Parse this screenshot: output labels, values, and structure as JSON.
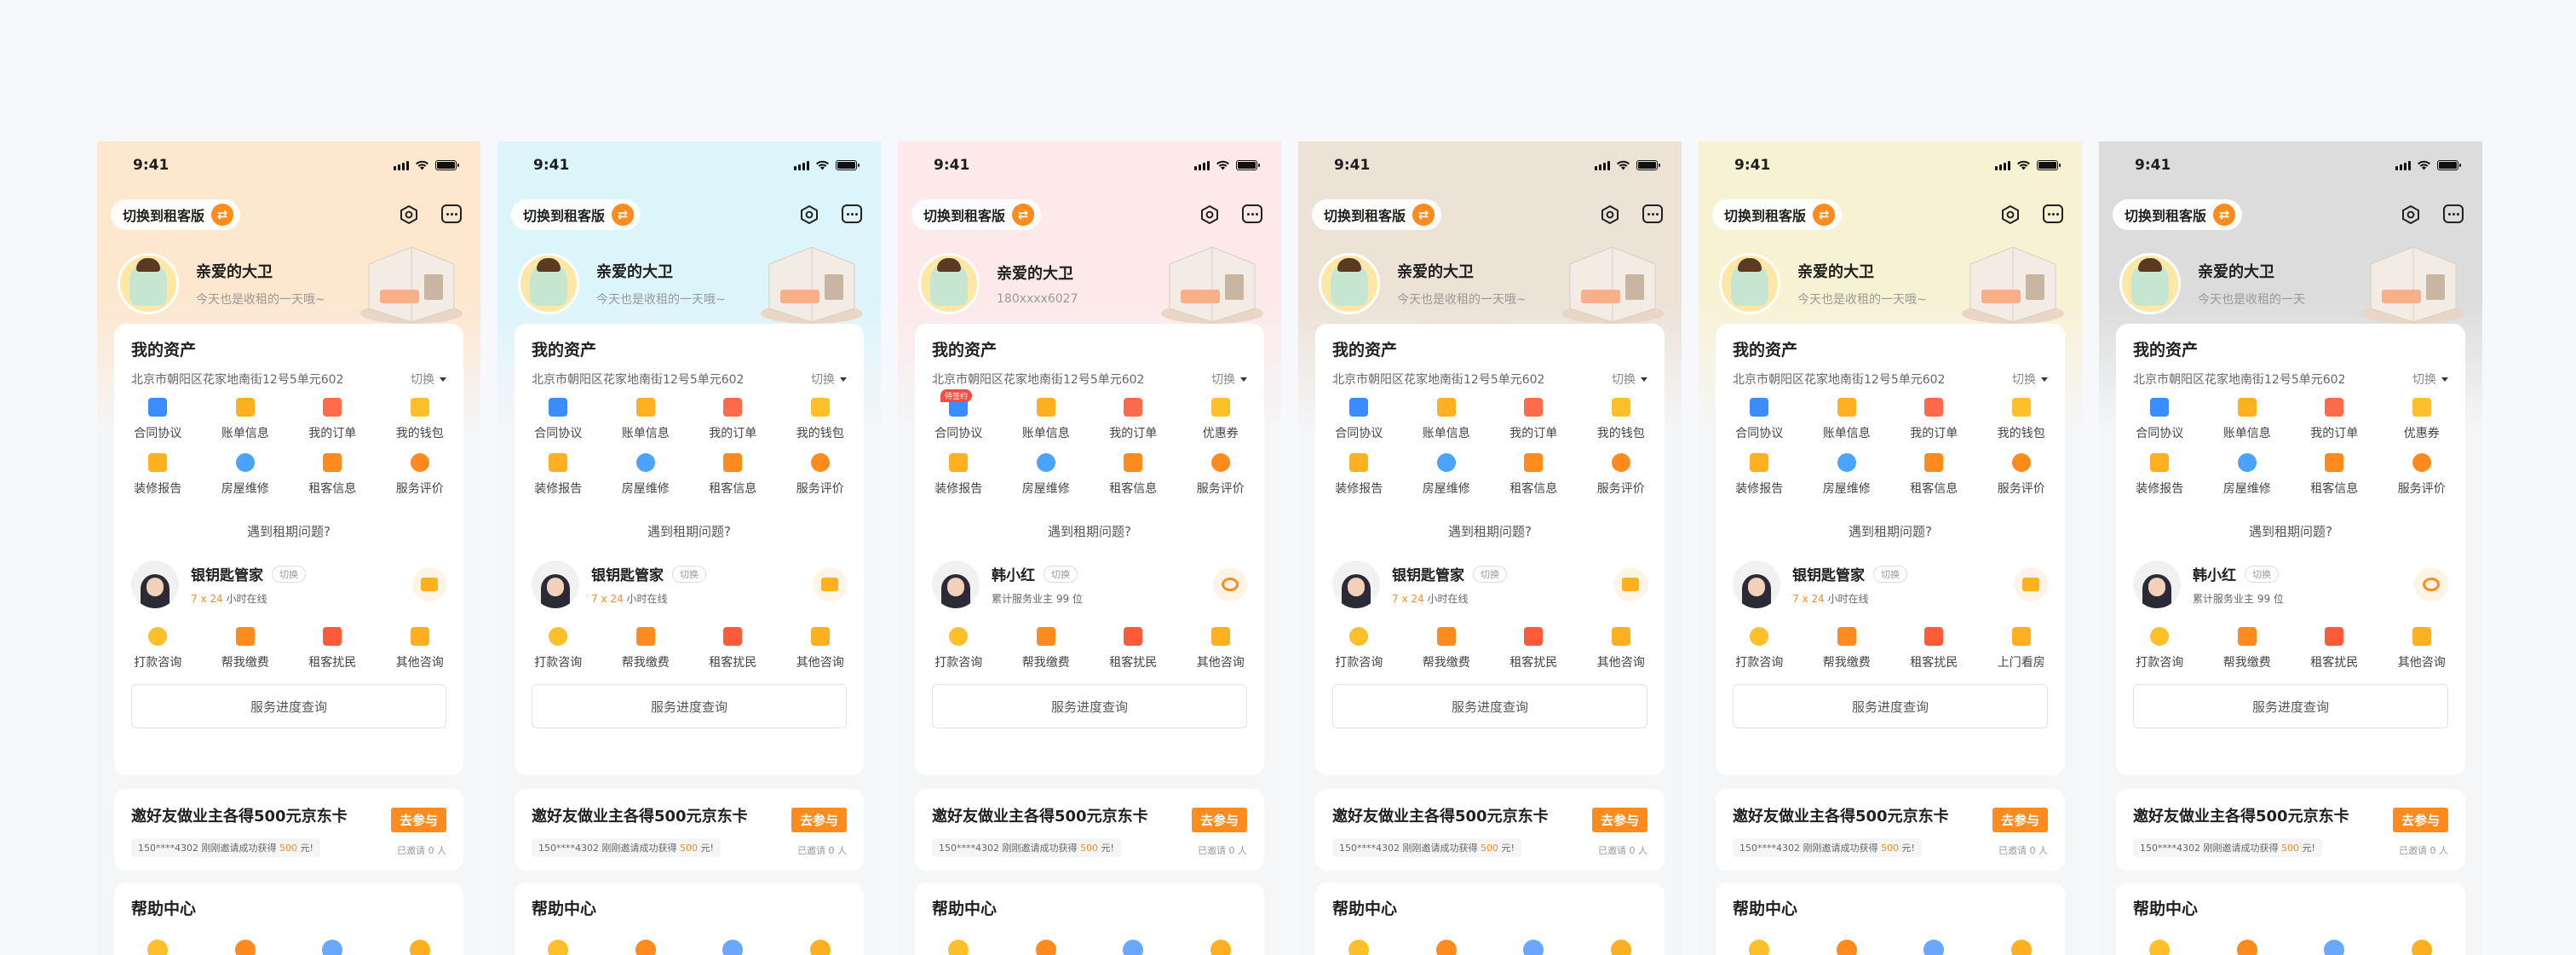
{
  "common": {
    "time": "9:41",
    "switch_label": "切换到租客版",
    "switch_icon": "swap-icon",
    "assets_title": "我的资产",
    "address": "北京市朝阳区花家地南街12号5单元602",
    "address_switch": "切换",
    "ask_label": "遇到租期问题?",
    "keeper_switch": "切换",
    "progress_label": "服务进度查询",
    "invite_title": "邀好友做业主各得500元京东卡",
    "invite_button": "去参与",
    "invite_note_prefix": "150****4302 刚刚邀请成功获得",
    "invite_note_amount": "500",
    "invite_note_suffix": "元!",
    "invite_count": "已邀请 0 人",
    "help_title": "帮助中心"
  },
  "phones": [
    {
      "bg": "#fde7cf",
      "greeting": "亲爱的大卫",
      "subtitle": "今天也是收租的一天哦~",
      "grid": [
        "合同协议",
        "账单信息",
        "我的订单",
        "我的钱包",
        "装修报告",
        "房屋维修",
        "租客信息",
        "服务评价"
      ],
      "badge": "",
      "keeper_name": "银钥匙管家",
      "keeper_avail_hl": "7 x 24",
      "keeper_avail": "小时在线",
      "keeper_action_icon": "chat-icon",
      "services": [
        "打款咨询",
        "帮我缴费",
        "租客扰民",
        "其他咨询"
      ]
    },
    {
      "bg": "#dcf5fb",
      "greeting": "亲爱的大卫",
      "subtitle": "今天也是收租的一天哦~",
      "grid": [
        "合同协议",
        "账单信息",
        "我的订单",
        "我的钱包",
        "装修报告",
        "房屋维修",
        "租客信息",
        "服务评价"
      ],
      "badge": "",
      "keeper_name": "银钥匙管家",
      "keeper_avail_hl": "7 x 24",
      "keeper_avail": "小时在线",
      "keeper_action_icon": "chat-icon",
      "services": [
        "打款咨询",
        "帮我缴费",
        "租客扰民",
        "其他咨询"
      ]
    },
    {
      "bg": "#fde9ea",
      "greeting": "亲爱的大卫",
      "subtitle": "180xxxx6027",
      "grid": [
        "合同协议",
        "账单信息",
        "我的订单",
        "优惠券",
        "装修报告",
        "房屋维修",
        "租客信息",
        "服务评价"
      ],
      "badge": "待签约",
      "keeper_name": "韩小红",
      "keeper_avail_hl": "99",
      "keeper_avail": "累计服务业主 99 位",
      "keeper_action_icon": "phone-icon",
      "services": [
        "打款咨询",
        "帮我缴费",
        "租客扰民",
        "其他咨询"
      ]
    },
    {
      "bg": "#ece2d6",
      "greeting": "亲爱的大卫",
      "subtitle": "今天也是收租的一天哦~",
      "grid": [
        "合同协议",
        "账单信息",
        "我的订单",
        "我的钱包",
        "装修报告",
        "房屋维修",
        "租客信息",
        "服务评价"
      ],
      "badge": "",
      "keeper_name": "银钥匙管家",
      "keeper_avail_hl": "7 x 24",
      "keeper_avail": "小时在线",
      "keeper_action_icon": "chat-icon",
      "services": [
        "打款咨询",
        "帮我缴费",
        "租客扰民",
        "其他咨询"
      ]
    },
    {
      "bg": "#f8f2d4",
      "greeting": "亲爱的大卫",
      "subtitle": "今天也是收租的一天哦~",
      "grid": [
        "合同协议",
        "账单信息",
        "我的订单",
        "我的钱包",
        "装修报告",
        "房屋维修",
        "租客信息",
        "服务评价"
      ],
      "badge": "",
      "keeper_name": "银钥匙管家",
      "keeper_avail_hl": "7 x 24",
      "keeper_avail": "小时在线",
      "keeper_action_icon": "chat-icon",
      "services": [
        "打款咨询",
        "帮我缴费",
        "租客扰民",
        "上门看房"
      ]
    },
    {
      "bg": "#dcdcdc",
      "greeting": "亲爱的大卫",
      "subtitle": "今天也是收租的一天",
      "grid": [
        "合同协议",
        "账单信息",
        "我的订单",
        "优惠券",
        "装修报告",
        "房屋维修",
        "租客信息",
        "服务评价"
      ],
      "badge": "",
      "keeper_name": "韩小红",
      "keeper_avail_hl": "99",
      "keeper_avail": "累计服务业主 99 位",
      "keeper_action_icon": "phone-icon",
      "services": [
        "打款咨询",
        "帮我缴费",
        "租客扰民",
        "其他咨询"
      ]
    }
  ],
  "grid_icon_names": [
    "contract-icon",
    "bill-icon",
    "order-icon",
    "wallet-icon",
    "report-icon",
    "repair-icon",
    "tenant-icon",
    "rating-icon"
  ],
  "grid_icon_colors": [
    "#3a8dff",
    "#ffb020",
    "#ff6b4a",
    "#ffbf2a",
    "#ffb020",
    "#4aa3ff",
    "#ff8a1e",
    "#ff8a1e"
  ],
  "service_icon_names": [
    "payment-consult-icon",
    "pay-bill-icon",
    "noise-icon",
    "other-consult-icon"
  ],
  "service_icon_colors": [
    "#ffbf2a",
    "#ff8a1e",
    "#ff5a3a",
    "#ffb020"
  ],
  "help_icon_colors": [
    "#ffbf2a",
    "#ff8a1e",
    "#6aa8ff",
    "#ffb020"
  ],
  "accent": "#ff8a1e"
}
